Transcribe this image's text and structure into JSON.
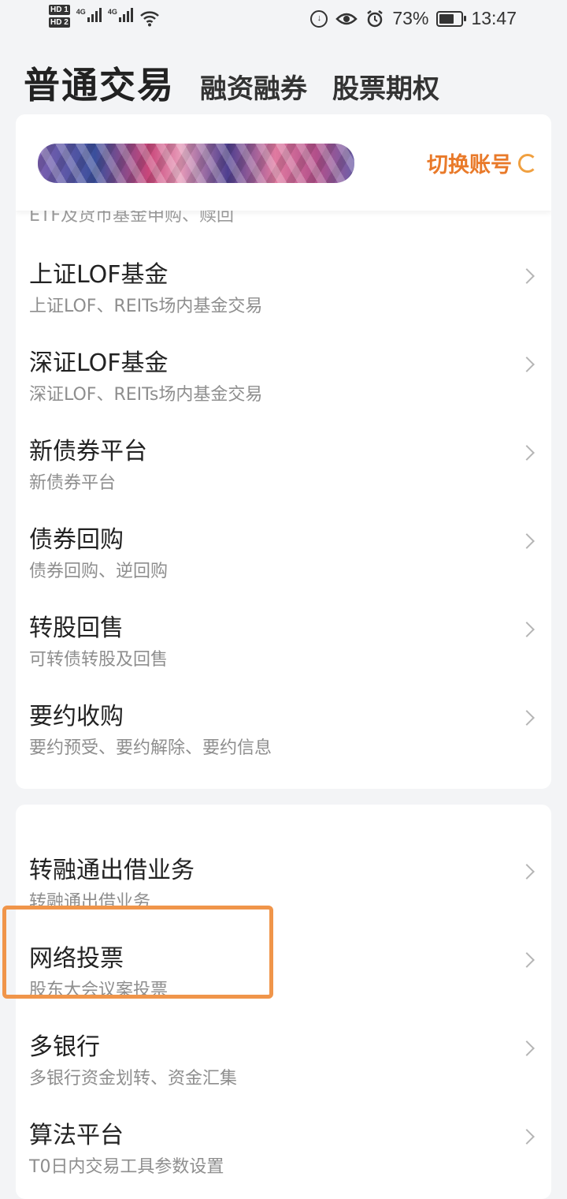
{
  "status_bar": {
    "hd1": "HD 1",
    "hd2": "HD 2",
    "net1": "4G",
    "net2": "4G",
    "battery": "73%",
    "battery_level": 0.73,
    "time": "13:47",
    "icons": [
      "data-saver-icon",
      "eye-icon",
      "alarm-icon",
      "battery-icon",
      "wifi-icon",
      "signal-icon"
    ]
  },
  "header": {
    "tabs": [
      {
        "label": "普通交易",
        "active": true
      },
      {
        "label": "融资融券",
        "active": false
      },
      {
        "label": "股票期权",
        "active": false
      }
    ]
  },
  "account": {
    "switch_label": "切换账号"
  },
  "card1": {
    "partial_item": "ETF及货币基金申购、赎回",
    "items": [
      {
        "title": "上证LOF基金",
        "subtitle": "上证LOF、REITs场内基金交易"
      },
      {
        "title": "深证LOF基金",
        "subtitle": "深证LOF、REITs场内基金交易"
      },
      {
        "title": "新债券平台",
        "subtitle": "新债券平台"
      },
      {
        "title": "债券回购",
        "subtitle": "债券回购、逆回购"
      },
      {
        "title": "转股回售",
        "subtitle": "可转债转股及回售"
      },
      {
        "title": "要约收购",
        "subtitle": "要约预受、要约解除、要约信息"
      }
    ]
  },
  "card2": {
    "items": [
      {
        "title": "转融通出借业务",
        "subtitle": "转融通出借业务"
      },
      {
        "title": "网络投票",
        "subtitle": "股东大会议案投票"
      },
      {
        "title": "多银行",
        "subtitle": "多银行资金划转、资金汇集"
      },
      {
        "title": "算法平台",
        "subtitle": "T0日内交易工具参数设置"
      }
    ]
  },
  "colors": {
    "accent": "#e97a2a",
    "highlight": "#f0954a",
    "background": "#f3f4f6"
  }
}
